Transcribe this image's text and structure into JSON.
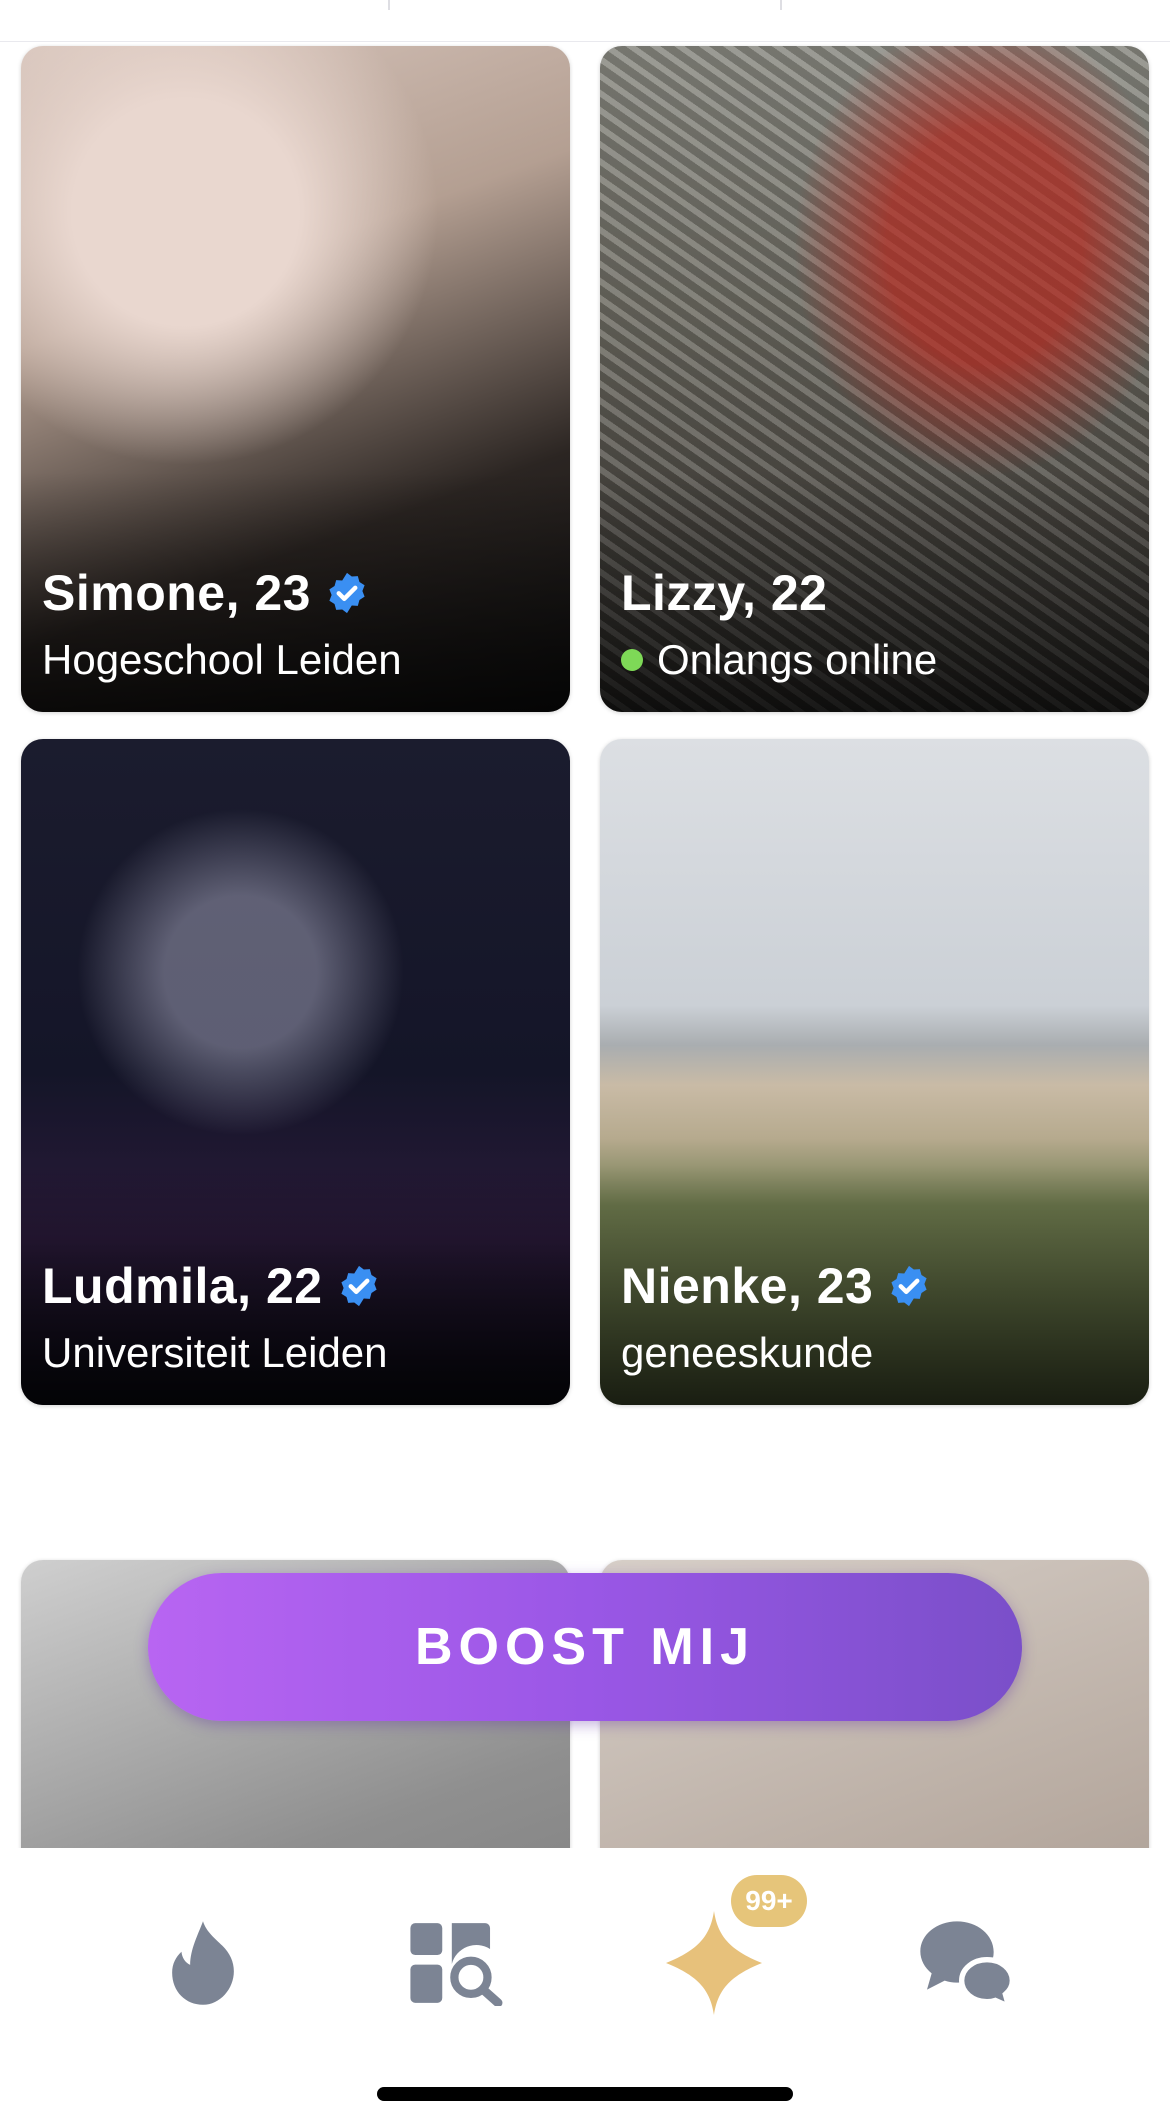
{
  "profiles": [
    {
      "name_age": "Simone, 23",
      "subtitle": "Hogeschool Leiden",
      "verified": true,
      "online": false
    },
    {
      "name_age": "Lizzy, 22",
      "subtitle": "Onlangs online",
      "verified": false,
      "online": true
    },
    {
      "name_age": "Ludmila, 22",
      "subtitle": "Universiteit Leiden",
      "verified": true,
      "online": false
    },
    {
      "name_age": "Nienke, 23",
      "subtitle": "geneeskunde",
      "verified": true,
      "online": false
    },
    {
      "name_age": "",
      "subtitle": ""
    },
    {
      "name_age": "",
      "subtitle": ""
    }
  ],
  "boost": {
    "label": "BOOST MIJ",
    "colors": [
      "#b865f2",
      "#7a4fc9"
    ]
  },
  "tabbar": {
    "tabs": [
      {
        "icon": "flame-icon"
      },
      {
        "icon": "explore-icon"
      },
      {
        "icon": "sparkle-icon",
        "badge": "99+",
        "active": true
      },
      {
        "icon": "chat-icon"
      }
    ]
  },
  "colors": {
    "verified": "#3a8ff2",
    "online": "#7ed957",
    "icon_inactive": "#7c8494",
    "icon_active": "#e7c17b"
  }
}
